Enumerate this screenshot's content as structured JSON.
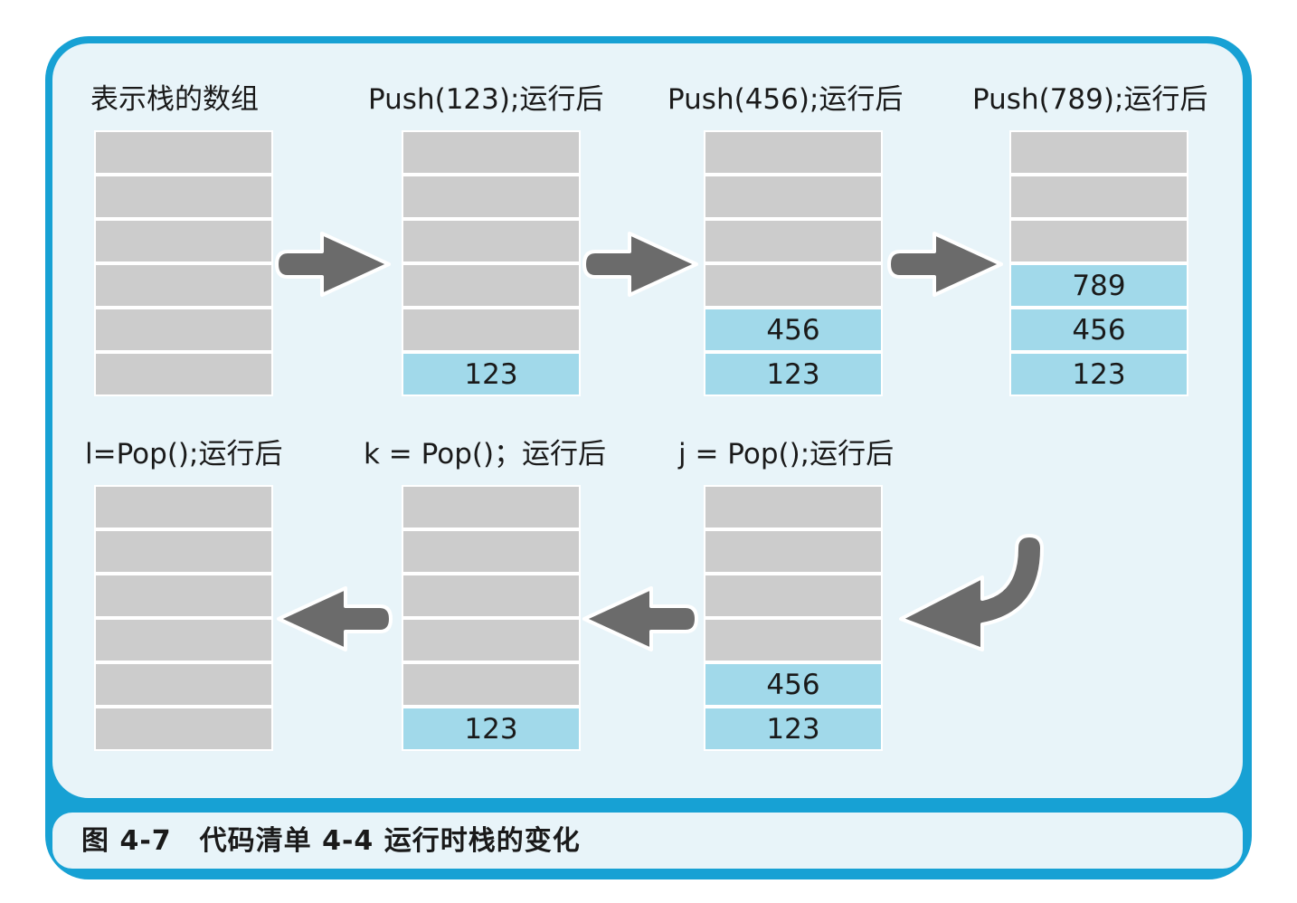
{
  "caption": "图 4-7　代码清单 4-4 运行时栈的变化",
  "stacks": [
    {
      "label": "表示栈的数组",
      "cells": [
        "",
        "",
        "",
        "",
        "",
        ""
      ]
    },
    {
      "label": "Push(123);运行后",
      "cells": [
        "",
        "",
        "",
        "",
        "",
        "123"
      ]
    },
    {
      "label": "Push(456);运行后",
      "cells": [
        "",
        "",
        "",
        "",
        "456",
        "123"
      ]
    },
    {
      "label": "Push(789);运行后",
      "cells": [
        "",
        "",
        "",
        "789",
        "456",
        "123"
      ]
    },
    {
      "label": "j = Pop();运行后",
      "cells": [
        "",
        "",
        "",
        "",
        "456",
        "123"
      ]
    },
    {
      "label": "k = Pop()；运行后",
      "cells": [
        "",
        "",
        "",
        "",
        "",
        "123"
      ]
    },
    {
      "label": "l=Pop();运行后",
      "cells": [
        "",
        "",
        "",
        "",
        "",
        ""
      ]
    }
  ],
  "colors": {
    "frame": "#17a1d4",
    "panel": "#e8f4f9",
    "empty_cell": "#cccccc",
    "filled_cell": "#a1d9ea",
    "arrow": "#6b6b6b"
  }
}
